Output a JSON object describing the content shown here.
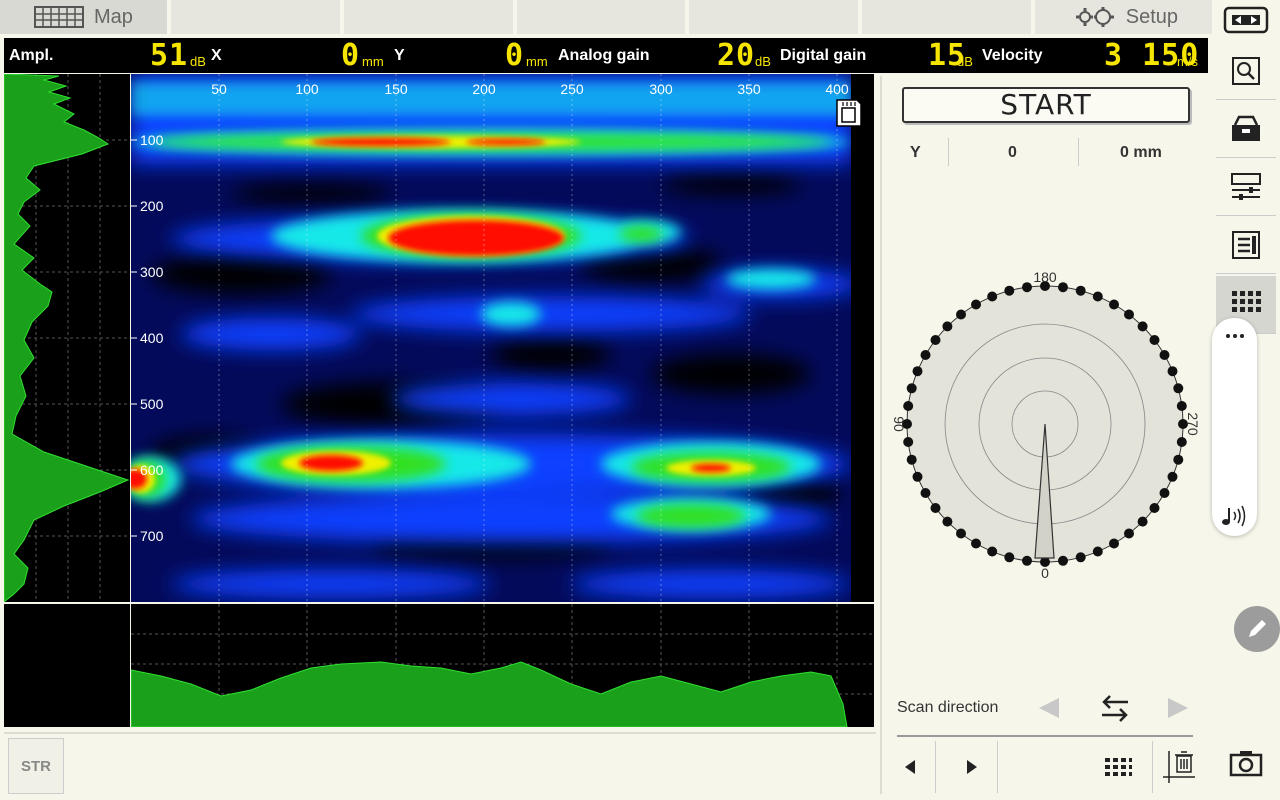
{
  "tabs": {
    "map_label": "Map",
    "setup_label": "Setup"
  },
  "status": {
    "ampl_label": "Ampl.",
    "ampl_value": "51",
    "ampl_unit": "dB",
    "x_label": "X",
    "x_value": "0",
    "x_unit": "mm",
    "y_label": "Y",
    "y_value": "0",
    "y_unit": "mm",
    "analog_label": "Analog gain",
    "analog_value": "20",
    "analog_unit": "dB",
    "digital_label": "Digital gain",
    "digital_value": "15",
    "digital_unit": "dB",
    "velocity_label": "Velocity",
    "velocity_value": "3 150",
    "velocity_unit": "m/s"
  },
  "map": {
    "x_ticks": [
      "50",
      "100",
      "150",
      "200",
      "250",
      "300",
      "350",
      "400"
    ],
    "y_ticks": [
      "100",
      "200",
      "300",
      "400",
      "500",
      "600",
      "700"
    ],
    "colors": {
      "low": "#000000",
      "mid": "#0a3cff",
      "cyan": "#18e8e8",
      "green": "#20e020",
      "yellow": "#f0f000",
      "high": "#ff1000"
    }
  },
  "right": {
    "start_label": "START",
    "y_label": "Y",
    "y_value": "0",
    "y_mm": "0 mm",
    "dial": {
      "top": "180",
      "left": "90",
      "right": "270",
      "bottom": "0",
      "needle_angle": 0
    },
    "scan_direction_label": "Scan direction"
  },
  "bottom": {
    "str_label": "STR"
  },
  "theme": {
    "bg": "#f6f6ea",
    "accent": "#f5e500",
    "trace": "#1aa01a"
  }
}
